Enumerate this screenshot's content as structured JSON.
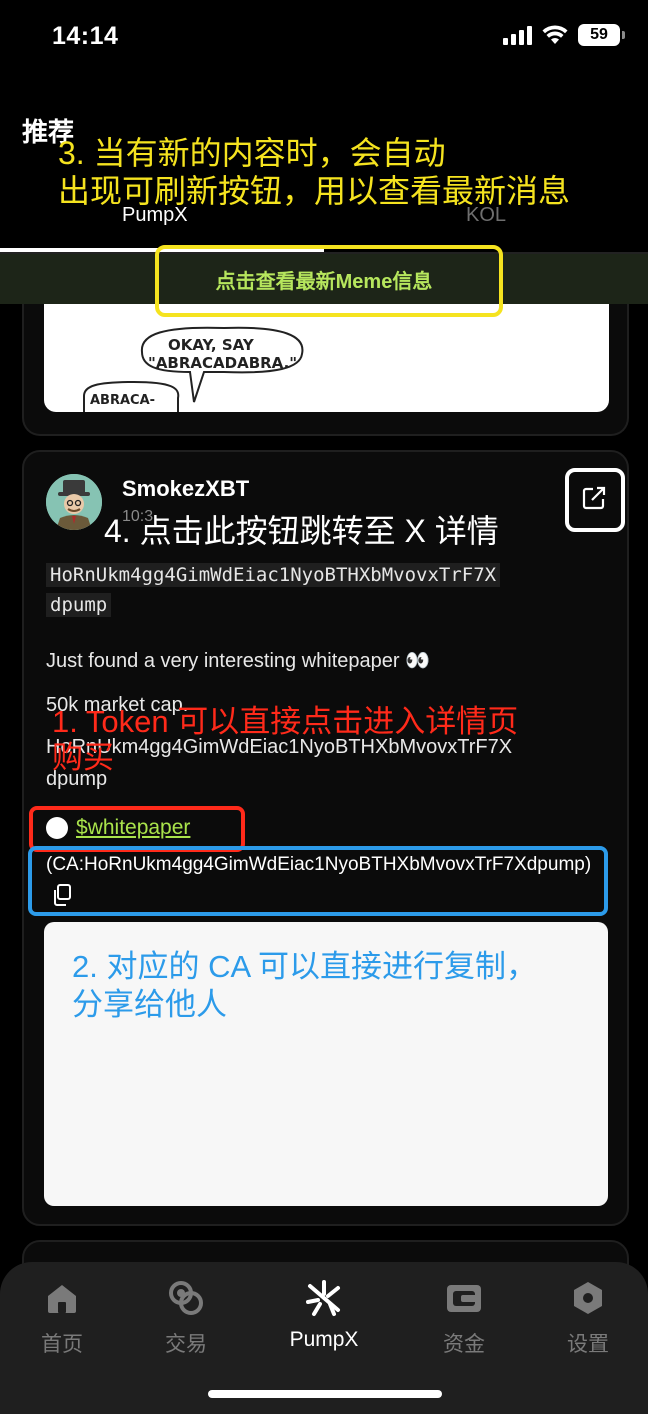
{
  "status_bar": {
    "time": "14:14",
    "battery": "59"
  },
  "header": {
    "title": "推荐",
    "tabs": [
      {
        "label": "PumpX",
        "active": true
      },
      {
        "label": "KOL",
        "active": false
      }
    ],
    "refresh_button": "点击查看最新Meme信息"
  },
  "post": {
    "author": "SmokezXBT",
    "time": "10:3",
    "ca_code_line1": "HoRnUkm4gg4GimWdEiac1NyoBTHXbMvovxTrF7X",
    "ca_code_line2": "dpump",
    "text_line1": "Just found a very interesting whitepaper 👀",
    "text_line2": "50k market cap.",
    "text_line3": "HoRnUkm4gg4GimWdEiac1NyoBTHXbMvovxTrF7X",
    "text_line4": "dpump",
    "token_symbol": "$whitepaper",
    "ca_text": "(CA:HoRnUkm4gg4GimWdEiac1NyoBTHXbMvovxTrF7Xdpump)"
  },
  "comic": {
    "bubble_main": "OKAY, SAY",
    "bubble_main2": "\"ABRACADABRA.\"",
    "bubble_small": "ABRACA-"
  },
  "annotations": {
    "yellow_line1": "3. 当有新的内容时，会自动",
    "yellow_line2": "出现可刷新按钮，用以查看最新消息",
    "white": "4. 点击此按钮跳转至 X 详情",
    "red_line1": "1. Token 可以直接点击进入详情页",
    "red_line2": "购买",
    "blue_line1": "2. 对应的 CA 可以直接进行复制，",
    "blue_line2": "分享给他人"
  },
  "bottom_nav": [
    {
      "label": "首页",
      "icon": "home-icon"
    },
    {
      "label": "交易",
      "icon": "trade-icon"
    },
    {
      "label": "PumpX",
      "icon": "pumpx-icon",
      "active": true
    },
    {
      "label": "资金",
      "icon": "wallet-icon"
    },
    {
      "label": "设置",
      "icon": "settings-icon"
    }
  ],
  "colors": {
    "accent_green": "#a9e34b",
    "annot_yellow": "#f5e31f",
    "annot_red": "#ff2a1a",
    "annot_blue": "#2c9bea"
  }
}
